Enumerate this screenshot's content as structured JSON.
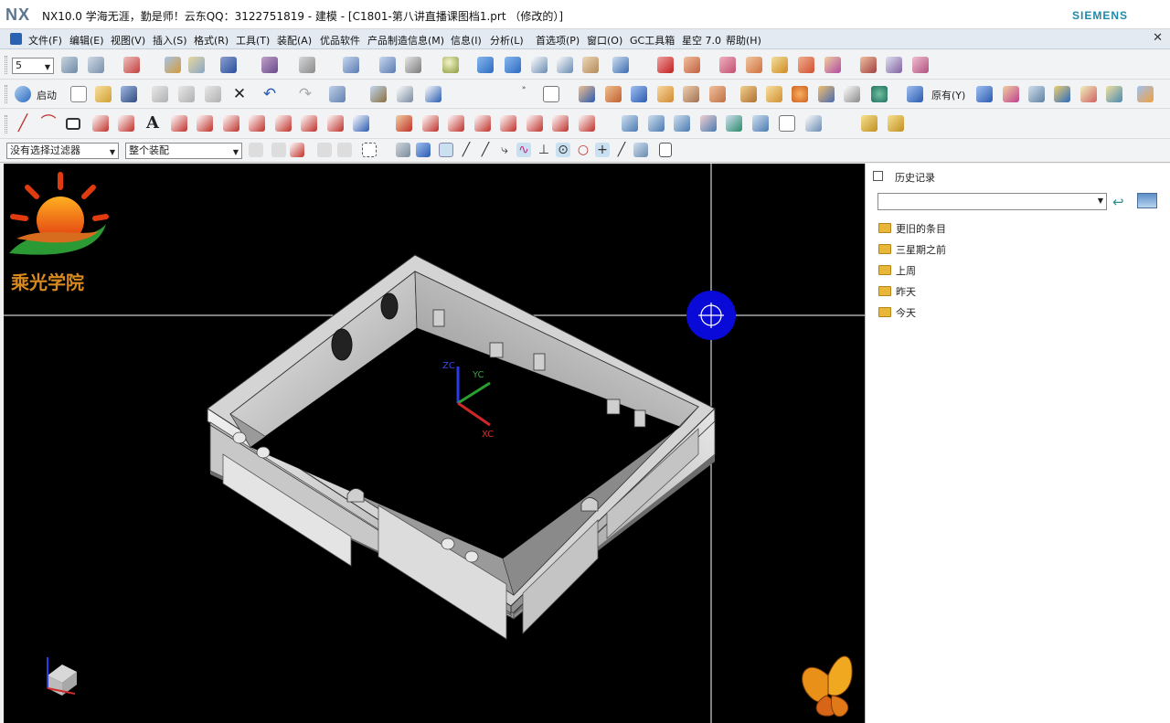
{
  "window": {
    "logo": "NX",
    "title": "NX10.0 学海无涯，勤是师！云东QQ：3122751819 - 建模 - [C1801-第八讲直播课图档1.prt （修改的）]",
    "brand": "SIEMENS"
  },
  "menu": [
    "文件(F)",
    "编辑(E)",
    "视图(V)",
    "插入(S)",
    "格式(R)",
    "工具(T)",
    "装配(A)",
    "优品软件",
    "产品制造信息(M)",
    "信息(I)",
    "分析(L)",
    "首选项(P)",
    "窗口(O)",
    "GC工具箱",
    "星空 7.0",
    "帮助(H)"
  ],
  "toolbar": {
    "layer_value": "5",
    "startup_label": "启动",
    "origin_label": "原有(Y)"
  },
  "selection": {
    "filter_value": "没有选择过滤器",
    "scope_value": "整个装配"
  },
  "viewport": {
    "logo_text": "乘光学院",
    "axis_labels": {
      "zc": "ZC",
      "yc": "YC",
      "xc": "XC"
    }
  },
  "history": {
    "title": "历史记录",
    "items": [
      "更旧的条目",
      "三星期之前",
      "上周",
      "昨天",
      "今天"
    ]
  },
  "colors": {
    "viewport_bg": "#000000",
    "cursor": "#0a0ad8",
    "brand": "#1f8aa8"
  }
}
